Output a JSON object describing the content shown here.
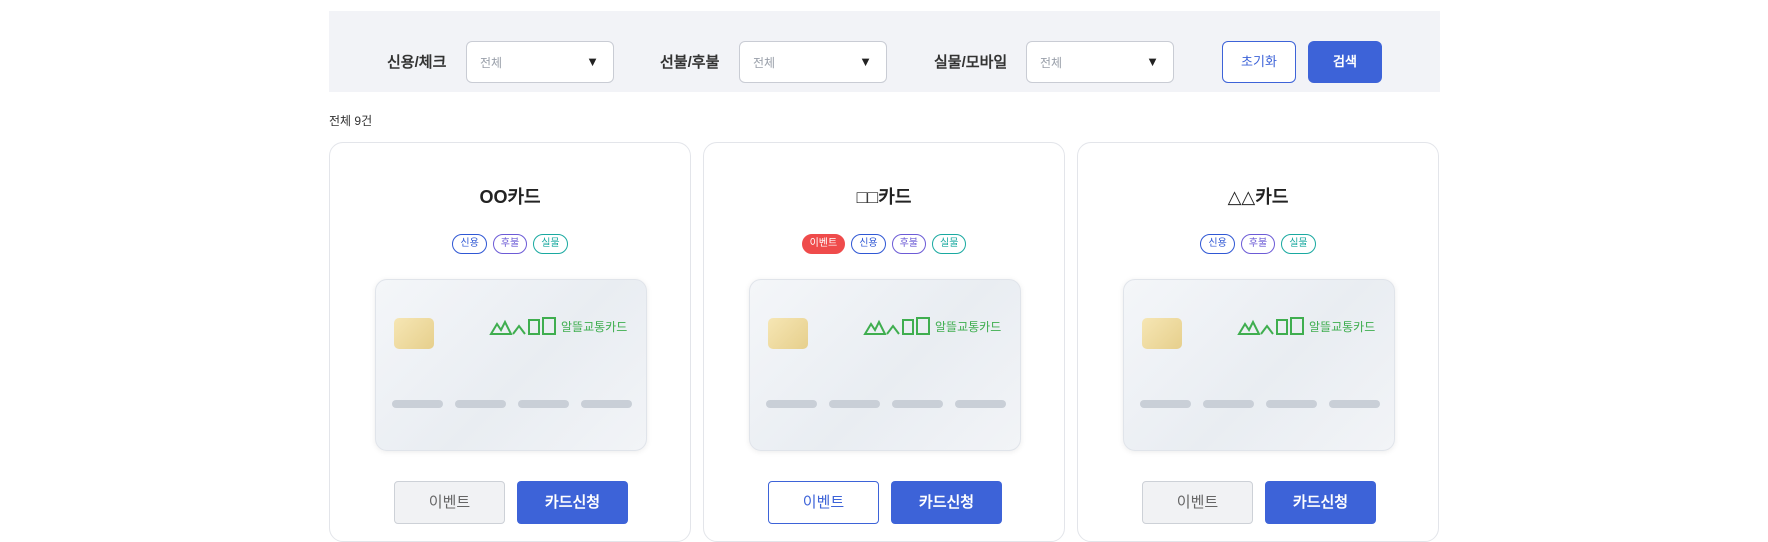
{
  "filters": {
    "credit_check": {
      "label": "신용/체크",
      "value": "전체"
    },
    "prepaid_postpaid": {
      "label": "선불/후불",
      "value": "전체"
    },
    "physical_mobile": {
      "label": "실물/모바일",
      "value": "전체"
    },
    "reset_label": "초기화",
    "search_label": "검색"
  },
  "result_count": "전체 9건",
  "cards": [
    {
      "title": "OO카드",
      "badges": [
        "신용",
        "후불",
        "실물"
      ],
      "logo_text": "알뜰교통카드",
      "event_label": "이벤트",
      "apply_label": "카드신청"
    },
    {
      "title": "□□카드",
      "badges": [
        "이벤트",
        "신용",
        "후불",
        "실물"
      ],
      "logo_text": "알뜰교통카드",
      "event_label": "이벤트",
      "apply_label": "카드신청"
    },
    {
      "title": "△△카드",
      "badges": [
        "신용",
        "후불",
        "실물"
      ],
      "logo_text": "알뜰교통카드",
      "event_label": "이벤트",
      "apply_label": "카드신청"
    }
  ],
  "colors": {
    "primary": "#3d63d8",
    "event_badge": "#ef4b4b",
    "logo_green": "#3fae4f"
  }
}
